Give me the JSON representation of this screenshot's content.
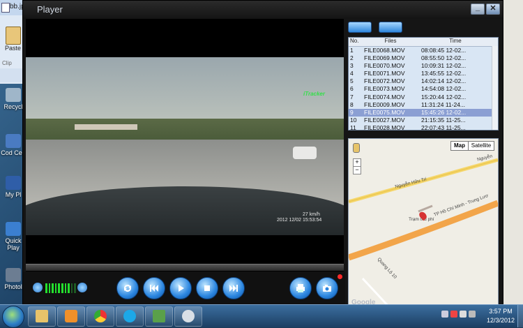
{
  "desktop": {
    "word": {
      "doc_tab": "bb.jp",
      "paste_label": "Paste",
      "clipboard_label": "Clip"
    },
    "icons": [
      {
        "label": "Recycl",
        "color": "#9fb6c9"
      },
      {
        "label": "Cod Cen",
        "color": "#4a7bc2"
      },
      {
        "label": "My Pl",
        "color": "#2f5ea8"
      },
      {
        "label": "Quick Play",
        "color": "#3b7fd0"
      },
      {
        "label": "Photol",
        "color": "#6c7d92"
      }
    ]
  },
  "player": {
    "title": "Player",
    "video": {
      "watermark": "iTracker",
      "speed_overlay": "27 km/h",
      "timestamp_overlay": "2012 12/02 15:53:54"
    },
    "controls": {
      "volume_level": 0.8,
      "buttons": [
        "repeat",
        "previous",
        "play",
        "stop",
        "next",
        "print",
        "snapshot"
      ]
    },
    "file_list": {
      "headers": {
        "no": "No.",
        "files": "Files",
        "time": "Time"
      },
      "rows": [
        {
          "no": "1",
          "file": "FILE0068.MOV",
          "time": "08:08:45 12-02..."
        },
        {
          "no": "2",
          "file": "FILE0069.MOV",
          "time": "08:55:50 12-02..."
        },
        {
          "no": "3",
          "file": "FILE0070.MOV",
          "time": "10:09:31 12-02..."
        },
        {
          "no": "4",
          "file": "FILE0071.MOV",
          "time": "13:45:55 12-02..."
        },
        {
          "no": "5",
          "file": "FILE0072.MOV",
          "time": "14:02:14 12-02..."
        },
        {
          "no": "6",
          "file": "FILE0073.MOV",
          "time": "14:54:08 12-02..."
        },
        {
          "no": "7",
          "file": "FILE0074.MOV",
          "time": "15:20:44 12-02..."
        },
        {
          "no": "8",
          "file": "FILE0009.MOV",
          "time": "11:31:24 11-24..."
        },
        {
          "no": "9",
          "file": "FILE0075.MOV",
          "time": "15:45:26 12-02...",
          "selected": true
        },
        {
          "no": "10",
          "file": "FILE0027.MOV",
          "time": "21:15:35 11-25..."
        },
        {
          "no": "11",
          "file": "FILE0028.MOV",
          "time": "22:07:43 11-25..."
        }
      ]
    },
    "map": {
      "type_map": "Map",
      "type_satellite": "Satellite",
      "labels": [
        "Nguyễn Hữu Trí",
        "Nguyễn",
        "TP Hồ Chí Minh - Trung Lươ",
        "Trạm thu phí",
        "Quang Lộ 10"
      ],
      "attribution": "Google"
    }
  },
  "taskbar": {
    "apps": [
      "file-explorer",
      "media-player",
      "chrome",
      "skype",
      "player-app",
      "paint"
    ],
    "clock_time": "3:57 PM",
    "clock_date": "12/3/2012"
  },
  "colors": {
    "accent": "#2e86dc",
    "selection": "#8b9fd3",
    "volume": "#24e02e",
    "record": "#ff2a2a"
  }
}
